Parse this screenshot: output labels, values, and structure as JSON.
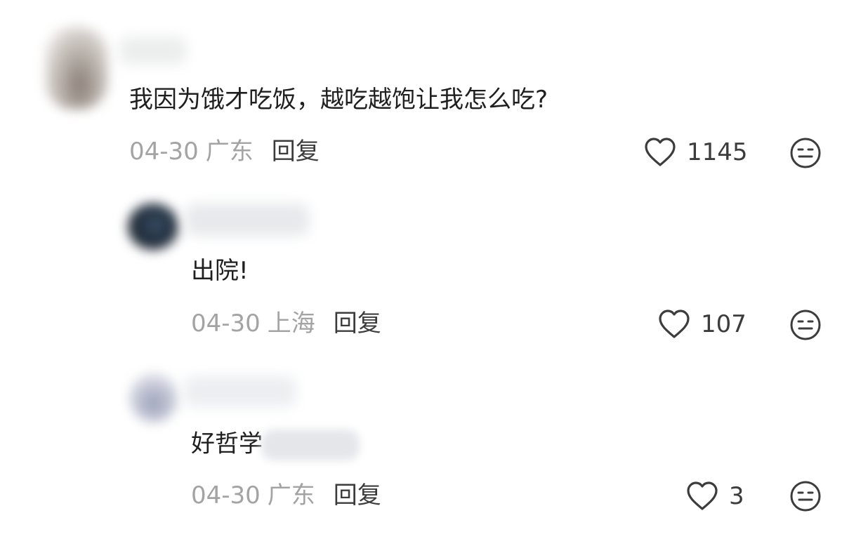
{
  "comments": [
    {
      "text": "我因为饿才吃饭，越吃越饱让我怎么吃?",
      "date": "04-30",
      "region": "广东",
      "reply_label": "回复",
      "likes": "1145"
    },
    {
      "text": "出院!",
      "date": "04-30",
      "region": "上海",
      "reply_label": "回复",
      "likes": "107"
    },
    {
      "text": "好哲学",
      "date": "04-30",
      "region": "广东",
      "reply_label": "回复",
      "likes": "3"
    }
  ],
  "icons": {
    "like": "heart-outline-icon",
    "reaction": "neutral-face-icon"
  },
  "colors": {
    "background": "#ffffff",
    "body_text": "#1f1f1f",
    "meta_text": "#a3a3a3",
    "action_text": "#3c3c3c"
  }
}
